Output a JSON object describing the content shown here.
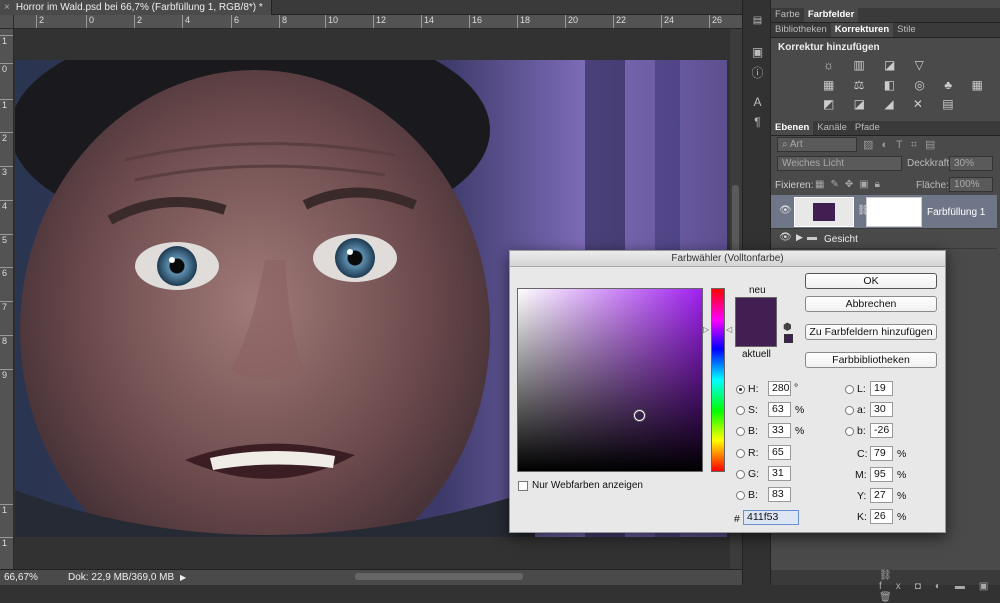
{
  "document": {
    "tab_title": "Horror im Wald.psd bei 66,7% (Farbfüllung 1, RGB/8*) *",
    "close_glyph": "×"
  },
  "rulers": {
    "horizontal": [
      "2",
      "0",
      "2",
      "4",
      "6",
      "8",
      "10",
      "12",
      "14",
      "16",
      "18",
      "20",
      "22",
      "24",
      "26"
    ],
    "vertical": [
      "1",
      "0",
      "1",
      "2",
      "3",
      "4",
      "5",
      "6",
      "7",
      "8",
      "9",
      "1",
      "1"
    ]
  },
  "status": {
    "zoom": "66,67%",
    "doc_info": "Dok: 22,9 MB/369,0 MB",
    "arrow": "▶"
  },
  "panels": {
    "top_tabs": [
      "Farbe",
      "Farbfelder"
    ],
    "top_active": "Farbfelder",
    "lib_tabs": [
      "Bibliotheken",
      "Korrekturen",
      "Stile"
    ],
    "lib_active": "Korrekturen",
    "adjust_heading": "Korrektur hinzufügen",
    "adjust_row1": "☼ ▥ ◪ ▽",
    "adjust_row2": "▦ ⚖ ◧ ◎ ♣ ▦",
    "adjust_row3": "◩ ◪ ◢ ✕ ▤",
    "layers_tabs": [
      "Ebenen",
      "Kanäle",
      "Pfade"
    ],
    "layers_active": "Ebenen",
    "filter_placeholder": "Art",
    "blend_mode": "Weiches Licht",
    "opacity_label": "Deckkraft:",
    "opacity_value": "30%",
    "lock_label": "Fixieren:",
    "fill_label": "Fläche:",
    "fill_value": "100%",
    "layers": [
      {
        "name": "Farbfüllung 1"
      },
      {
        "name": "Gesicht"
      }
    ]
  },
  "dialog": {
    "title": "Farbwähler (Volltonfarbe)",
    "new_label": "neu",
    "current_label": "aktuell",
    "ok": "OK",
    "cancel": "Abbrechen",
    "add_swatches": "Zu Farbfeldern hinzufügen",
    "libraries": "Farbbibliotheken",
    "web_only": "Nur Webfarben anzeigen",
    "hash": "#",
    "hex": "411f53",
    "hsb": [
      {
        "label": "H:",
        "value": "280",
        "unit": "°"
      },
      {
        "label": "S:",
        "value": "63",
        "unit": "%"
      },
      {
        "label": "B:",
        "value": "33",
        "unit": "%"
      }
    ],
    "rgb": [
      {
        "label": "R:",
        "value": "65"
      },
      {
        "label": "G:",
        "value": "31"
      },
      {
        "label": "B:",
        "value": "83"
      }
    ],
    "lab": [
      {
        "label": "L:",
        "value": "19"
      },
      {
        "label": "a:",
        "value": "30"
      },
      {
        "label": "b:",
        "value": "-26"
      }
    ],
    "cmyk": [
      {
        "label": "C:",
        "value": "79",
        "unit": "%"
      },
      {
        "label": "M:",
        "value": "95",
        "unit": "%"
      },
      {
        "label": "Y:",
        "value": "27",
        "unit": "%"
      },
      {
        "label": "K:",
        "value": "26",
        "unit": "%"
      }
    ],
    "new_color": "#411f53",
    "current_color": "#411f53"
  }
}
